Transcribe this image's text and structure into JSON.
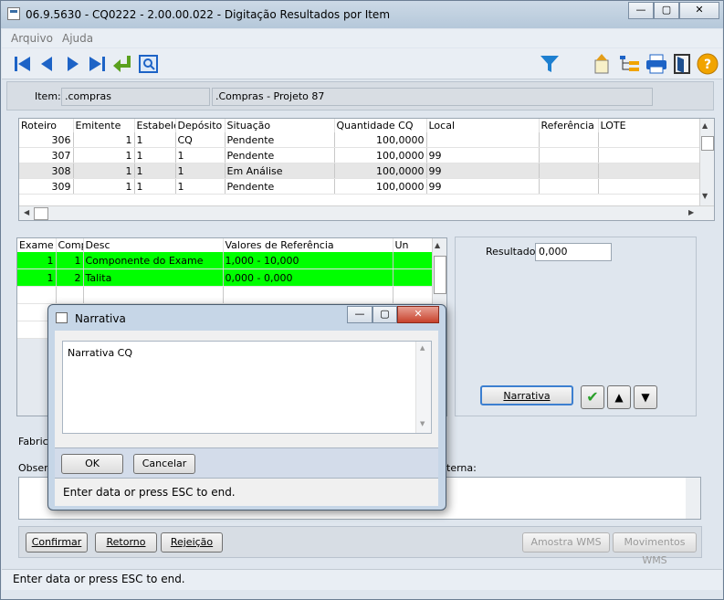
{
  "window": {
    "title": "06.9.5630 - CQ0222 - 2.00.00.022 - Digitação Resultados por Item",
    "minimize": "—",
    "maximize": "▢",
    "close": "✕"
  },
  "menu": [
    "Arquivo",
    "Ajuda"
  ],
  "toolbar": {
    "icons": [
      "first-icon",
      "prev-icon",
      "next-icon",
      "last-icon",
      "goto-icon",
      "search-icon",
      "filter-icon",
      "export-icon",
      "tree-icon",
      "print-icon",
      "exit-icon",
      "help-icon"
    ],
    "help_glyph": "?"
  },
  "item": {
    "label": "Item:",
    "code": ".compras",
    "description": ".Compras - Projeto 87"
  },
  "top_grid": {
    "columns": [
      "Roteiro",
      "Emitente",
      "Estabelec",
      "Depósito",
      "Situação",
      "Quantidade CQ",
      "Local",
      "Referência",
      "LOTE"
    ],
    "rows": [
      [
        "306",
        "1",
        "1",
        "CQ",
        "Pendente",
        "100,0000",
        "",
        "",
        ""
      ],
      [
        "307",
        "1",
        "1",
        "1",
        "Pendente",
        "100,0000",
        "99",
        "",
        ""
      ],
      [
        "308",
        "1",
        "1",
        "1",
        "Em Análise",
        "100,0000",
        "99",
        "",
        ""
      ],
      [
        "309",
        "1",
        "1",
        "1",
        "Pendente",
        "100,0000",
        "99",
        "",
        ""
      ]
    ]
  },
  "exam_grid": {
    "columns": [
      "Exame",
      "Comp",
      "Desc",
      "Valores de Referência",
      "Un"
    ],
    "rows": [
      [
        "1",
        "1",
        "Componente do Exame",
        "1,000 - 10,000",
        ""
      ],
      [
        "1",
        "2",
        "Talita",
        "0,000 - 0,000",
        ""
      ]
    ]
  },
  "result": {
    "label": "Resultado:",
    "value": "0,000",
    "narrativa_button": "Narrativa",
    "check_glyph": "✔",
    "up_glyph": "▲",
    "down_glyph": "▼"
  },
  "labels": {
    "fabricante_partial": "Fabrica",
    "observacao_partial": "Observ",
    "interna_partial": "terna:"
  },
  "bottom_buttons": {
    "confirmar": "Confirmar",
    "retorno": "Retorno",
    "rejeicao": "Rejeição",
    "amostra_wms": "Amostra WMS",
    "movimentos_wms": "Movimentos WMS"
  },
  "status_text": "Enter data or press ESC to end.",
  "dialog": {
    "title": "Narrativa",
    "text": "Narrativa CQ",
    "ok": "OK",
    "cancel": "Cancelar",
    "status": "Enter data or press ESC to end.",
    "minimize": "—",
    "maximize": "▢",
    "close": "✕"
  },
  "colors": {
    "selected_row": "#00ff00",
    "highlight_row": "#e6e6e6",
    "accent_blue": "#1d63c6",
    "help_orange": "#f1a400"
  }
}
